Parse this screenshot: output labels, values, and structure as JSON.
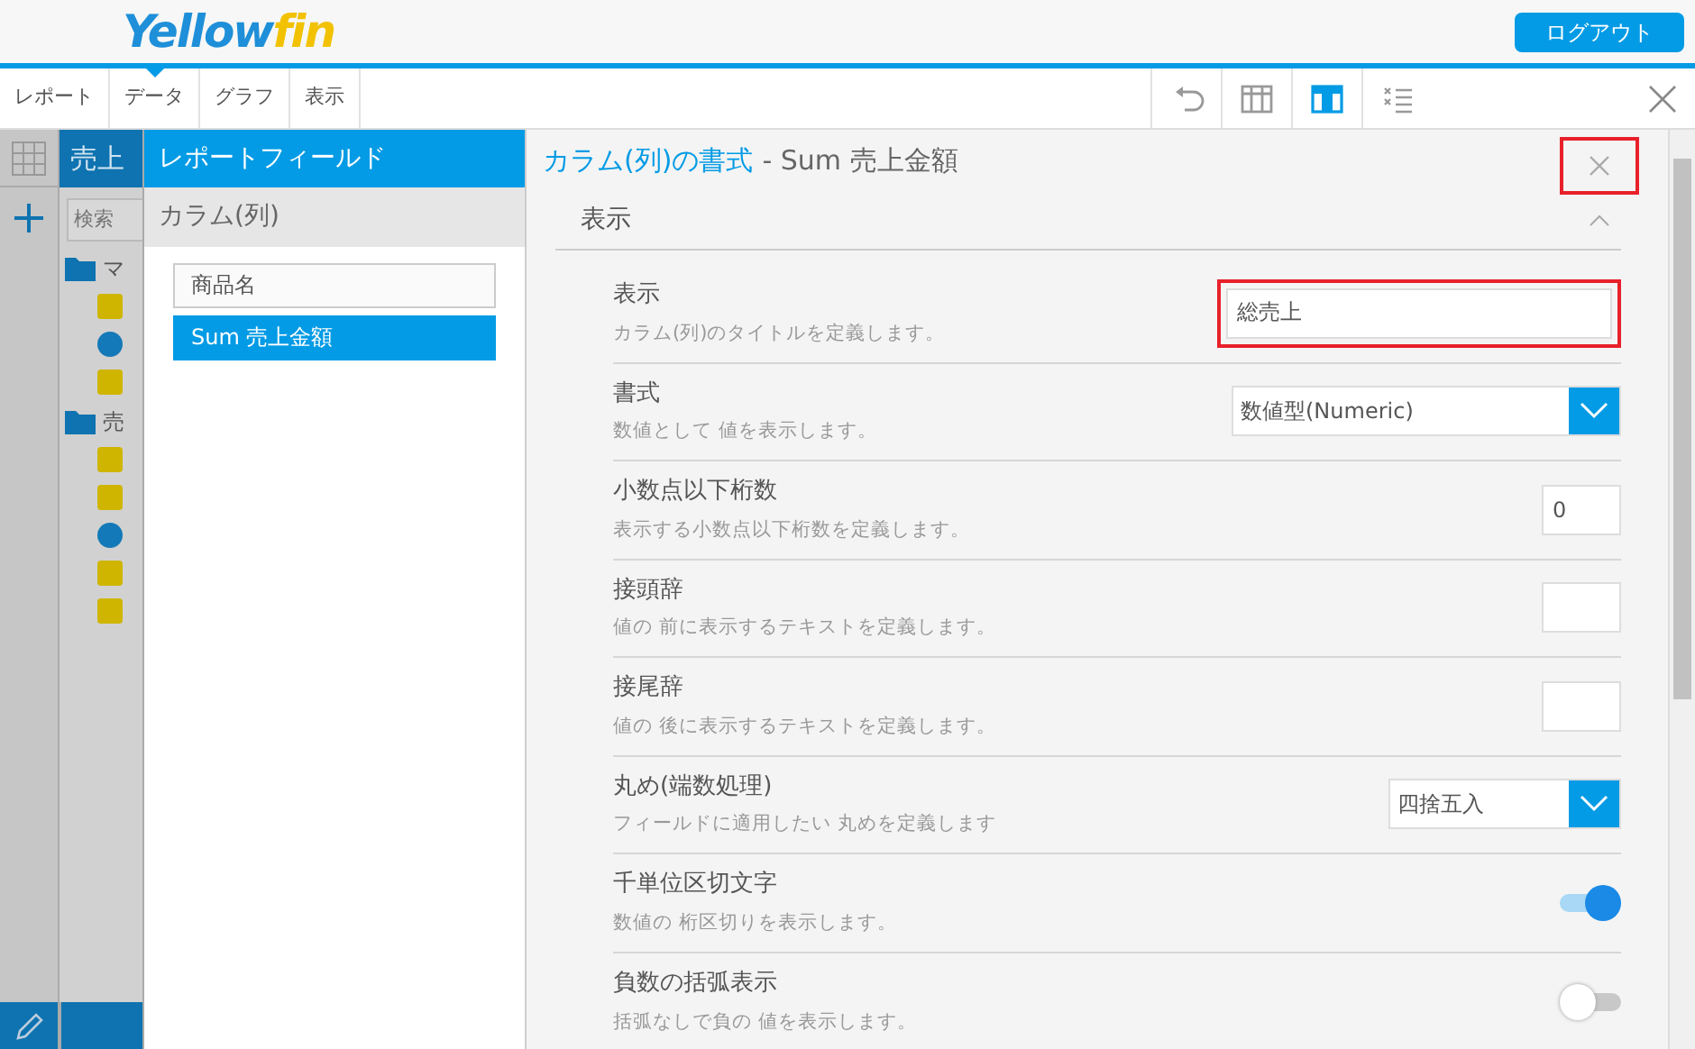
{
  "header": {
    "logo_first": "Yellow",
    "logo_second": "fin",
    "logout_button": "ログアウト"
  },
  "toolbar": {
    "tabs": [
      {
        "label": "レポート",
        "selected": false
      },
      {
        "label": "データ",
        "selected": true
      },
      {
        "label": "グラフ",
        "selected": false
      },
      {
        "label": "表示",
        "selected": false
      }
    ],
    "tools": [
      {
        "kind": "undo",
        "selected": false
      },
      {
        "kind": "table",
        "selected": false
      },
      {
        "kind": "columns",
        "selected": true
      },
      {
        "kind": "list",
        "selected": false
      }
    ]
  },
  "data_panel": {
    "title": "売上",
    "search": {
      "placeholder": "検索"
    },
    "folders": [
      {
        "label": "マ",
        "items": [
          {
            "kind": "dimension"
          },
          {
            "kind": "metric"
          },
          {
            "kind": "dimension"
          }
        ]
      },
      {
        "label": "売",
        "items": [
          {
            "kind": "dimension"
          },
          {
            "kind": "dimension"
          },
          {
            "kind": "metric"
          },
          {
            "kind": "dimension"
          },
          {
            "kind": "dimension"
          }
        ]
      }
    ]
  },
  "fields_panel": {
    "title": "レポートフィールド",
    "section": "カラム(列)",
    "fields": [
      {
        "label": "商品名",
        "selected": false
      },
      {
        "label": "Sum 売上金額",
        "selected": true
      }
    ]
  },
  "format_panel": {
    "title": "カラム(列)の書式",
    "subtitle": "- Sum 売上金額",
    "close_highlighted": true,
    "section": {
      "label": "表示",
      "expanded": true
    },
    "rows": [
      {
        "kind": "text",
        "label": "表示",
        "description": "カラム(列)のタイトルを定義します。",
        "value": "総売上",
        "highlighted": true
      },
      {
        "kind": "select",
        "label": "書式",
        "description": "数値として 値を表示します。",
        "value": "数値型(Numeric)"
      },
      {
        "kind": "small",
        "label": "小数点以下桁数",
        "description": "表示する小数点以下桁数を定義します。",
        "value": "0"
      },
      {
        "kind": "small",
        "label": "接頭辞",
        "description": "値の 前に表示するテキストを定義します。"
      },
      {
        "kind": "small",
        "label": "接尾辞",
        "description": "値の 後に表示するテキストを定義します。"
      },
      {
        "kind": "select_short",
        "label": "丸め(端数処理)",
        "description": "フィールドに適用したい 丸めを定義します",
        "value": "四捨五入"
      },
      {
        "kind": "toggle",
        "label": "千単位区切文字",
        "description": "数値の 桁区切りを表示します。",
        "on": true
      },
      {
        "kind": "toggle",
        "label": "負数の括弧表示",
        "description": "括弧なしで負の 値を表示します。",
        "on": false
      }
    ]
  }
}
